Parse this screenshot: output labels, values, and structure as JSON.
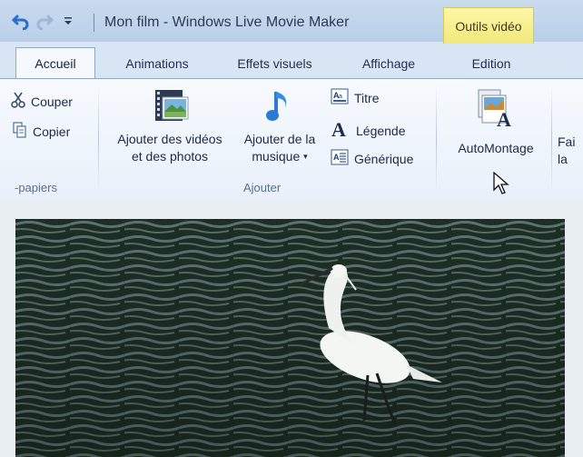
{
  "window": {
    "title": "Mon film - Windows Live Movie Maker",
    "context_tab": "Outils vidéo"
  },
  "tabs": [
    "Accueil",
    "Animations",
    "Effets visuels",
    "Affichage",
    "Edition"
  ],
  "ribbon": {
    "clipboard": {
      "cut": "Couper",
      "copy": "Copier",
      "group_label": "-papiers"
    },
    "add": {
      "add_videos_line1": "Ajouter des vidéos",
      "add_videos_line2": "et des photos",
      "add_music_line1": "Ajouter de la",
      "add_music_line2": "musique",
      "title": "Titre",
      "caption": "Légende",
      "credits": "Générique",
      "group_label": "Ajouter"
    },
    "automovie": {
      "label": "AutoMontage"
    },
    "partial": {
      "line1": "Fai",
      "line2": "la"
    }
  },
  "icons": {
    "undo": "undo-icon",
    "redo": "redo-icon",
    "qat_dropdown": "chevron-down-icon",
    "cut": "scissors-icon",
    "copy": "copy-icon",
    "add_media": "filmstrip-photo-icon",
    "add_music": "music-note-icon",
    "title": "title-icon",
    "caption": "caption-icon",
    "credits": "credits-icon",
    "automovie": "automovie-icon",
    "cursor": "mouse-pointer-icon"
  }
}
